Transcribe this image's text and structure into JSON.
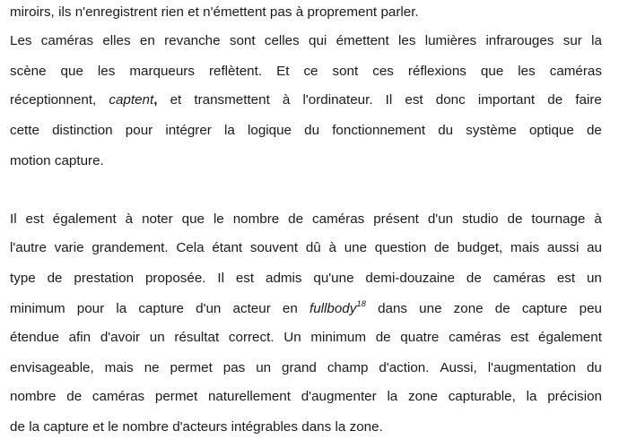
{
  "paragraphs": [
    {
      "lines": [
        [
          {
            "t": "miroirs, ils n'enregistrent rien et n'émettent pas à proprement parler."
          }
        ]
      ],
      "last_only": true
    },
    {
      "lines": [
        [
          {
            "t": "Les caméras elles en revanche sont celles qui émettent les lumières infrarouges sur la"
          }
        ],
        [
          {
            "t": "scène que les marqueurs reflètent. Et ce sont ces réflexions que les caméras"
          }
        ],
        [
          {
            "t": "réceptionnent,"
          },
          {
            "t": "captent",
            "i": true,
            "sep": ""
          },
          {
            "t": ",",
            "b": true
          },
          {
            "t": "et transmettent à l'ordinateur. Il est donc important de faire"
          }
        ],
        [
          {
            "t": "cette distinction pour intégrer la logique du fonctionnement du système optique de"
          }
        ],
        [
          {
            "t": "motion capture."
          }
        ]
      ]
    },
    {
      "lines": [
        [
          {
            "t": "Il est également à noter que le nombre de caméras présent d'un studio de tournage à"
          }
        ],
        [
          {
            "t": "l'autre varie grandement. Cela étant souvent dû à une question de budget, mais aussi au"
          }
        ],
        [
          {
            "t": "type de prestation proposée. Il est admis qu'une demi-douzaine de caméras est un"
          }
        ],
        [
          {
            "t": "minimum pour la capture d'un acteur en"
          },
          {
            "t": "fullbody",
            "i": true,
            "sup": "18"
          },
          {
            "t": "dans une zone de capture peu"
          }
        ],
        [
          {
            "t": "étendue afin d'avoir un résultat correct. Un minimum de quatre caméras est également"
          }
        ],
        [
          {
            "t": "envisageable, mais ne permet pas un grand champ d'action. Aussi, l'augmentation du"
          }
        ],
        [
          {
            "t": "nombre de caméras permet naturellement d'augmenter la zone capturable, la précision"
          }
        ],
        [
          {
            "t": "de la capture et le nombre d'acteurs intégrables dans la zone."
          }
        ]
      ]
    }
  ]
}
